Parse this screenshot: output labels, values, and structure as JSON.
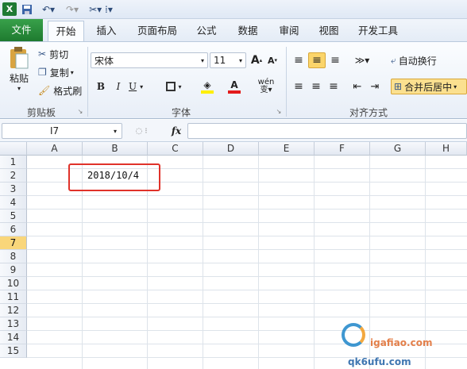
{
  "quick_access": {
    "logo": "X",
    "logo_icon": "excel-logo-icon",
    "save_icon": "save-icon",
    "undo_icon": "undo-icon",
    "redo_icon": "redo-icon",
    "customize_icon": "customize-icon"
  },
  "tabs": [
    {
      "label": "文件"
    },
    {
      "label": "开始"
    },
    {
      "label": "插入"
    },
    {
      "label": "页面布局"
    },
    {
      "label": "公式"
    },
    {
      "label": "数据"
    },
    {
      "label": "审阅"
    },
    {
      "label": "视图"
    },
    {
      "label": "开发工具"
    }
  ],
  "clipboard": {
    "paste_label": "粘贴",
    "cut_label": "剪切",
    "copy_label": "复制",
    "format_painter_label": "格式刷",
    "group_label": "剪贴板"
  },
  "font": {
    "name": "宋体",
    "size": "11",
    "grow_label": "A",
    "shrink_label": "A",
    "bold_label": "B",
    "italic_label": "I",
    "underline_label": "U",
    "color_label": "A",
    "wen_label": "wén",
    "group_label": "字体"
  },
  "alignment": {
    "wrap_text_label": "自动换行",
    "merge_center_label": "合并后居中",
    "group_label": "对齐方式"
  },
  "formula_bar": {
    "name_box": "I7",
    "fx_label": "fx",
    "formula": ""
  },
  "grid": {
    "columns": [
      "A",
      "B",
      "C",
      "D",
      "E",
      "F",
      "G",
      "H"
    ],
    "rows": [
      "1",
      "2",
      "3",
      "4",
      "5",
      "6",
      "7",
      "8",
      "9",
      "10",
      "11",
      "12",
      "13",
      "14",
      "15"
    ],
    "selected_row": "7",
    "cell_B2": "2018/10/4"
  },
  "watermark": {
    "text": "qk6ufu.com",
    "url_text": "igafiao.com"
  }
}
